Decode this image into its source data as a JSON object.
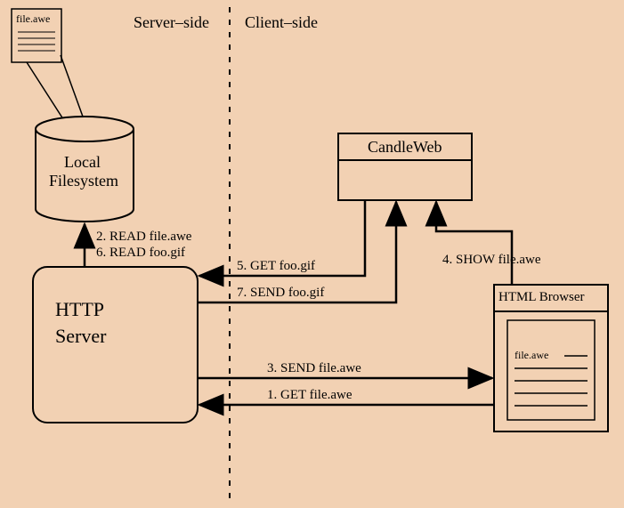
{
  "header": {
    "server_side": "Server–side",
    "client_side": "Client–side"
  },
  "file_icon": {
    "label": "file.awe"
  },
  "filesystem": {
    "line1": "Local",
    "line2": "Filesystem"
  },
  "http_server": {
    "line1": "HTTP",
    "line2": "Server"
  },
  "candleweb": {
    "label": "CandleWeb"
  },
  "browser": {
    "title": "HTML Browser",
    "doc_label": "file.awe"
  },
  "steps": {
    "s1": "1. GET file.awe",
    "s2": "2. READ file.awe",
    "s3": "3. SEND file.awe",
    "s4": "4. SHOW file.awe",
    "s5": "5. GET foo.gif",
    "s6": "6. READ foo.gif",
    "s7": "7. SEND foo.gif"
  }
}
